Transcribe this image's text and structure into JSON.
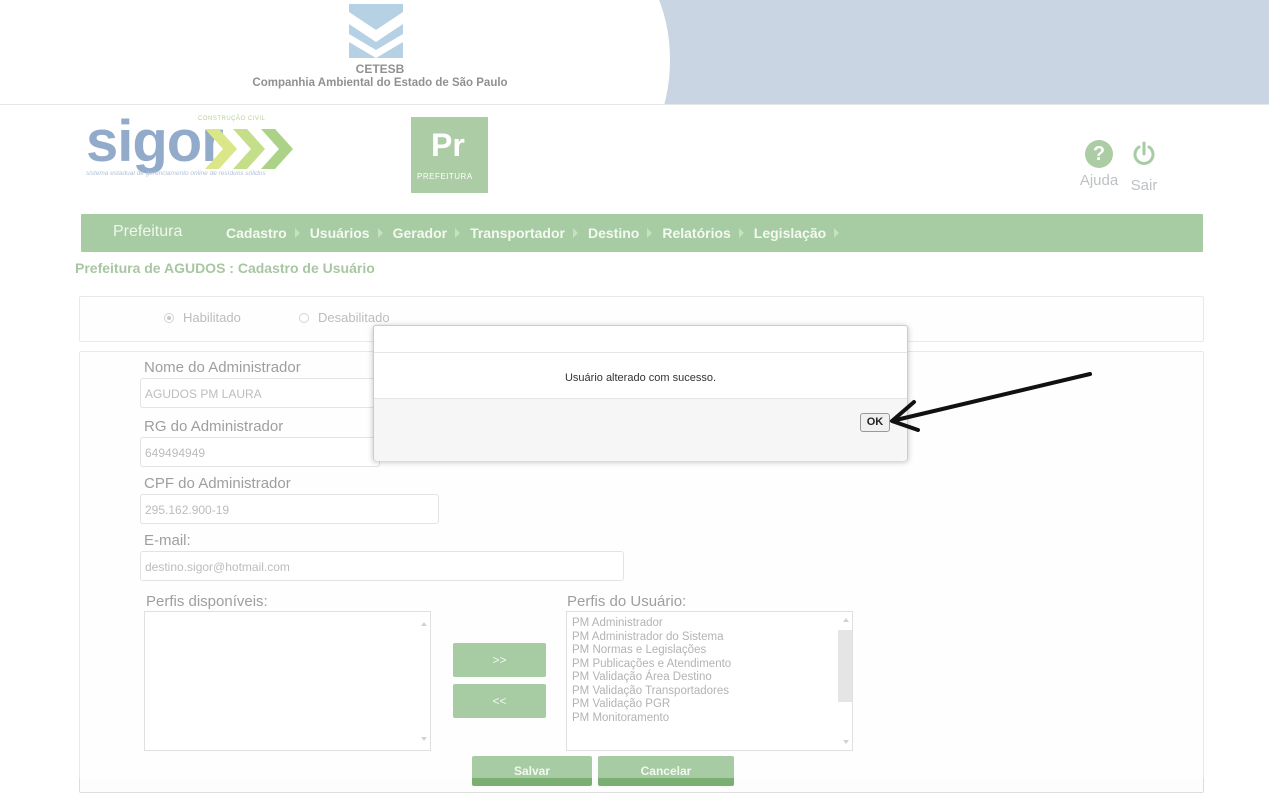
{
  "header": {
    "org_short": "CETESB",
    "org_full": "Companhia Ambiental do Estado de São Paulo"
  },
  "brand": {
    "logo_word": "sigor",
    "logo_small": "CONSTRUÇÃO CIVIL",
    "tagline": "sistema estadual de gerenciamento online de resíduos sólidos",
    "module_badge_big": "Pr",
    "module_badge_small": "PREFEITURA"
  },
  "toolbar": {
    "help_label": "Ajuda",
    "help_glyph": "?",
    "exit_label": "Sair"
  },
  "nav": {
    "home": "Prefeitura",
    "items": [
      "Cadastro",
      "Usuários",
      "Gerador",
      "Transportador",
      "Destino",
      "Relatórios",
      "Legislação"
    ]
  },
  "page": {
    "heading": "Prefeitura de AGUDOS : Cadastro de Usuário"
  },
  "status": {
    "options": [
      {
        "label": "Habilitado",
        "selected": true
      },
      {
        "label": "Desabilitado",
        "selected": false
      }
    ]
  },
  "form": {
    "name_label": "Nome do Administrador",
    "name_value": "AGUDOS PM LAURA",
    "rg_label": "RG do Administrador",
    "rg_value": "649494949",
    "cpf_label": "CPF do Administrador",
    "cpf_value": "295.162.900-19",
    "email_label": "E-mail:",
    "email_value": "destino.sigor@hotmail.com",
    "available_label": "Perfis disponíveis:",
    "user_profiles_label": "Perfis do Usuário:",
    "user_profiles": [
      "PM Administrador",
      "PM Administrador do Sistema",
      "PM Normas e Legislações",
      "PM Publicações e Atendimento",
      "PM Validação Área Destino",
      "PM Validação Transportadores",
      "PM Validação PGR",
      "PM Monitoramento"
    ],
    "add_button": ">>",
    "remove_button": "<<",
    "save_button": "Salvar",
    "cancel_button": "Cancelar"
  },
  "dialog": {
    "message": "Usuário alterado com sucesso.",
    "ok_label": "OK"
  },
  "colors": {
    "green": "#79b072",
    "blue": "#5a7fb0"
  }
}
